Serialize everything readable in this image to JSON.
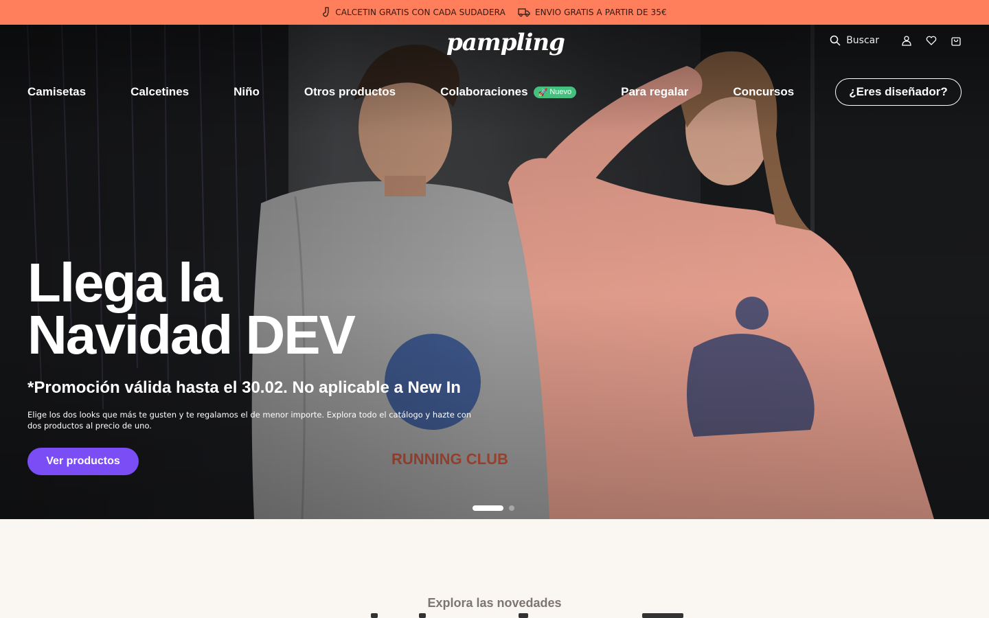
{
  "promo": {
    "item1": "CALCETIN GRATIS CON CADA SUDADERA",
    "item1_icon": "sock-icon",
    "item2": "ENVIO GRATIS A PARTIR DE 35€",
    "item2_icon": "truck-icon",
    "bg_color": "#ff7f5c"
  },
  "header": {
    "logo": "pampling",
    "search_label": "Buscar",
    "icons": [
      "search-icon",
      "user-icon",
      "heart-icon",
      "bag-icon"
    ]
  },
  "nav": {
    "items": [
      {
        "label": "Camisetas"
      },
      {
        "label": "Calcetines"
      },
      {
        "label": "Niño"
      },
      {
        "label": "Otros productos"
      },
      {
        "label": "Colaboraciones",
        "badge": "Nuevo"
      },
      {
        "label": "Para regalar"
      },
      {
        "label": "Concursos"
      }
    ],
    "designer_button": "¿Eres diseñador?"
  },
  "hero": {
    "title_line1": "Llega la",
    "title_line2": "Navidad DEV",
    "subtitle": "*Promoción válida hasta el 30.02. No aplicable a New In",
    "description": "Elige los dos looks que más te gusten y te regalamos el de menor importe. Explora todo el catálogo y hazte con dos productos al precio de uno.",
    "cta": "Ver productos",
    "cta_color": "#7a4df5",
    "slides_total": 2,
    "slide_active": 1
  },
  "section": {
    "explore_title": "Explora las novedades"
  }
}
